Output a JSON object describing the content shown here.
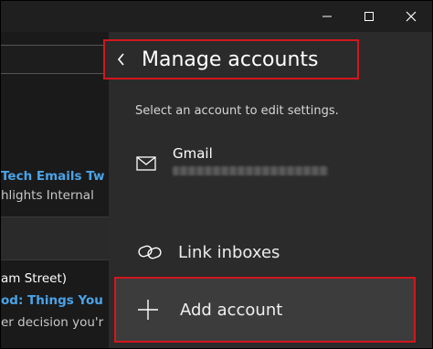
{
  "window": {
    "minimize_icon": "minimize-icon",
    "maximize_icon": "maximize-icon",
    "close_icon": "close-icon"
  },
  "mail_list": {
    "items": [
      {
        "line2": "Tech Emails Tw",
        "line3": "hlights Internal"
      },
      {
        "line1": "am Street)",
        "line2": "od: Things You",
        "line3": "er decision you'r"
      }
    ]
  },
  "manage_accounts": {
    "back_icon": "chevron-left-icon",
    "title": "Manage accounts",
    "hint": "Select an account to edit settings.",
    "account": {
      "name": "Gmail",
      "icon": "mail-envelope-icon"
    },
    "link_inboxes": {
      "label": "Link inboxes",
      "icon": "link-icon"
    },
    "add_account": {
      "label": "Add account",
      "icon": "plus-icon"
    }
  },
  "colors": {
    "highlight_border": "#d3171d",
    "pane_bg": "#2b2b2b",
    "link_blue": "#4aa3e8"
  }
}
